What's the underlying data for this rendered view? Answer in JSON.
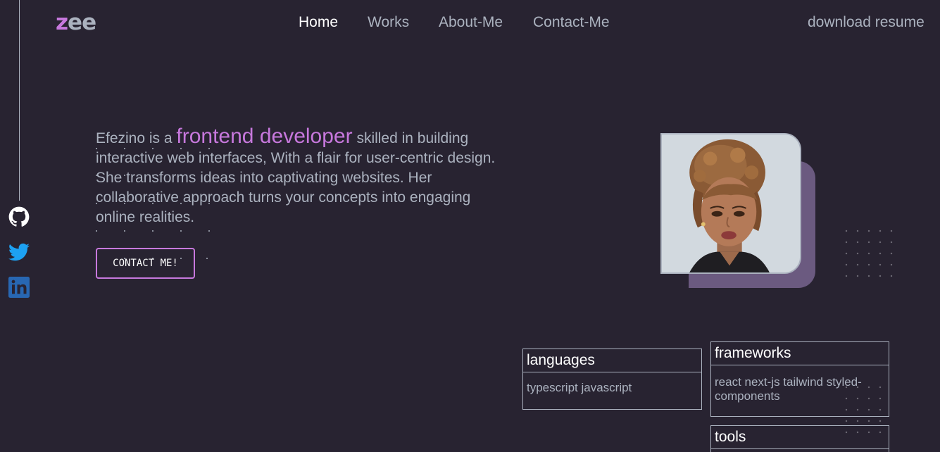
{
  "brand": {
    "logo_z": "z",
    "logo_rest": "ee"
  },
  "nav": {
    "home": "Home",
    "works": "Works",
    "about": "About-Me",
    "contact": "Contact-Me",
    "resume": "download resume"
  },
  "social": [
    {
      "name": "github",
      "icon": "github-icon"
    },
    {
      "name": "twitter",
      "icon": "twitter-icon"
    },
    {
      "name": "linkedin",
      "icon": "linkedin-icon"
    }
  ],
  "hero": {
    "intro": "Efezino is a",
    "role": "frontend developer",
    "description": "skilled in building interactive web interfaces, With a flair for user-centric design. She transforms ideas into captivating websites. Her collaborative approach turns your concepts into engaging online realities.",
    "cta": "CONTACT ME!"
  },
  "skills": {
    "languages": {
      "title": "languages",
      "items": "typescript javascript"
    },
    "frameworks": {
      "title": "frameworks",
      "items": "react next-js tailwind styled-components"
    },
    "tools": {
      "title": "tools",
      "items": ""
    }
  },
  "colors": {
    "background": "#282331",
    "accent": "#c778dd",
    "text": "#abb2bf",
    "white": "#ffffff",
    "avatar_shadow": "#6b5a80",
    "github": "#ffffff",
    "twitter": "#1da1f2",
    "linkedin": "#2867b2"
  }
}
